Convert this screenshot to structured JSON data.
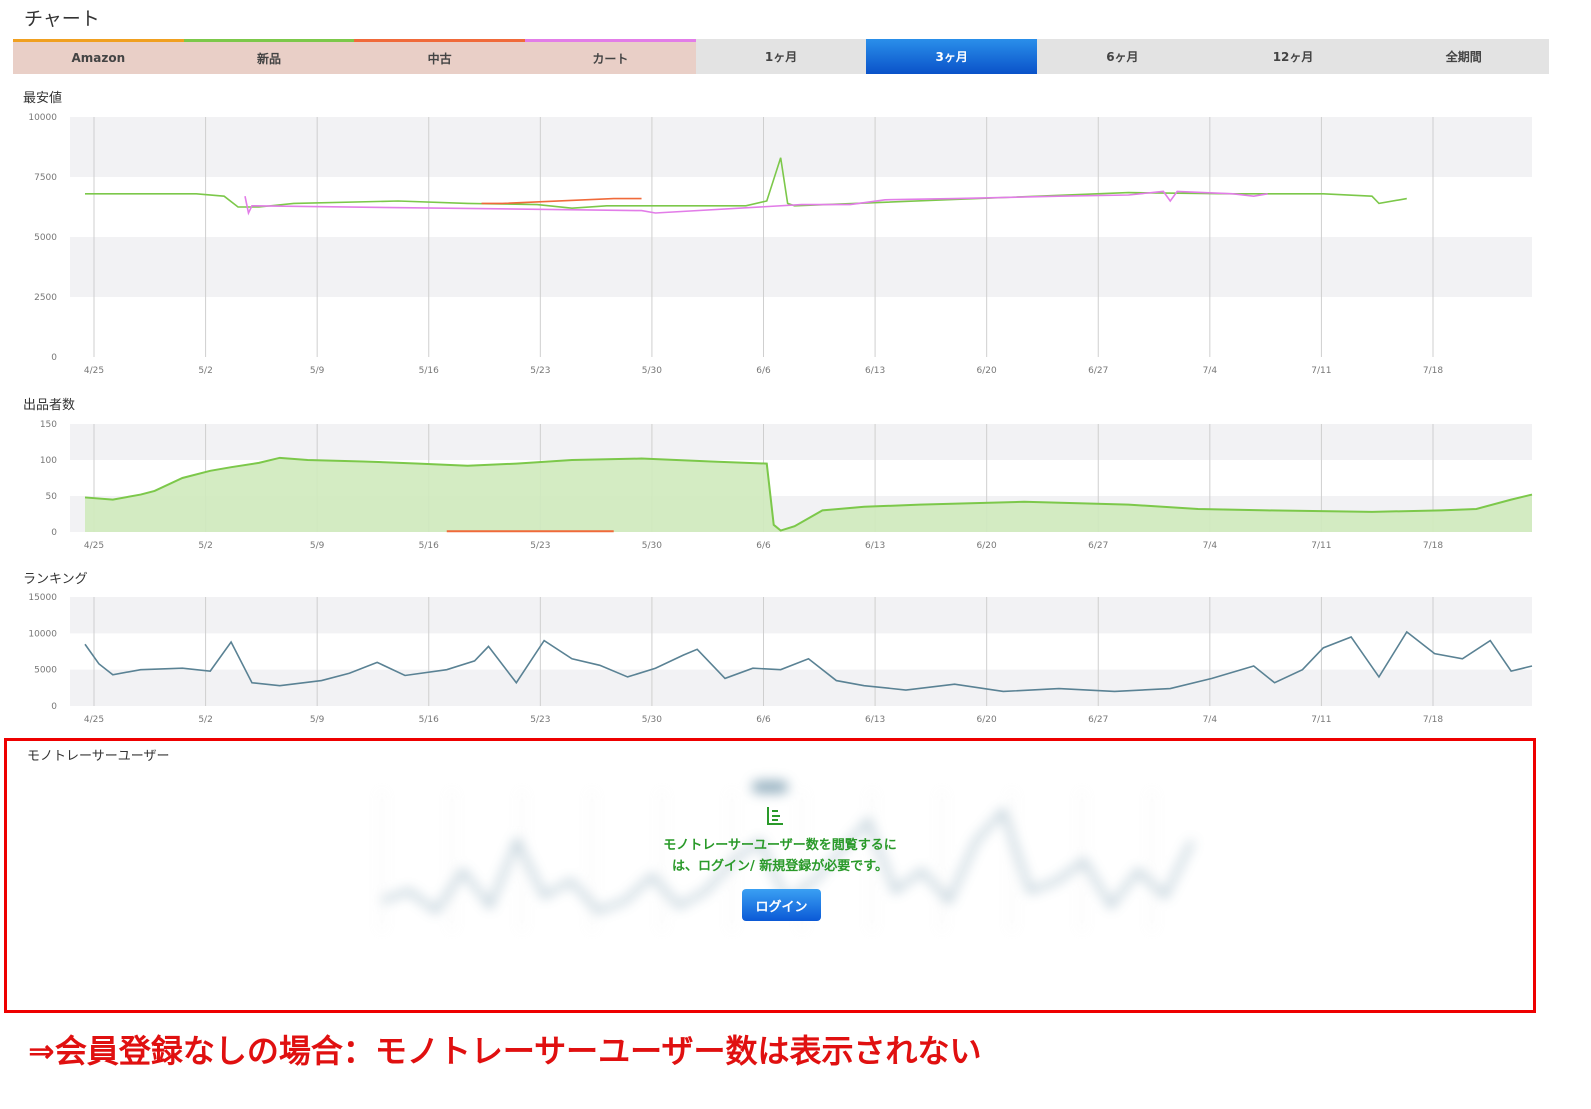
{
  "page_title": "チャート",
  "filters": [
    {
      "label": "Amazon",
      "color": "#f0a020"
    },
    {
      "label": "新品",
      "color": "#7cc84a"
    },
    {
      "label": "中古",
      "color": "#f06a3a"
    },
    {
      "label": "カート",
      "color": "#e27de8"
    }
  ],
  "periods": [
    {
      "label": "1ヶ月",
      "active": false
    },
    {
      "label": "3ヶ月",
      "active": true
    },
    {
      "label": "6ヶ月",
      "active": false
    },
    {
      "label": "12ヶ月",
      "active": false
    },
    {
      "label": "全期間",
      "active": false
    }
  ],
  "chart_data": [
    {
      "type": "line",
      "title": "最安値",
      "x": [
        "4/25",
        "5/2",
        "5/9",
        "5/16",
        "5/23",
        "5/30",
        "6/6",
        "6/13",
        "6/20",
        "6/27",
        "7/4",
        "7/11",
        "7/18"
      ],
      "ylim": [
        0,
        10000
      ],
      "yticks": [
        0,
        2500,
        5000,
        7500,
        10000
      ],
      "grid": true,
      "series": [
        {
          "name": "新品",
          "color": "#7cc84a",
          "points": [
            [
              0,
              6800
            ],
            [
              16,
              6800
            ],
            [
              20,
              6700
            ],
            [
              22,
              6250
            ],
            [
              25,
              6250
            ],
            [
              30,
              6400
            ],
            [
              45,
              6500
            ],
            [
              55,
              6400
            ],
            [
              65,
              6350
            ],
            [
              70,
              6200
            ],
            [
              75,
              6300
            ],
            [
              95,
              6300
            ],
            [
              98,
              6500
            ],
            [
              100,
              8300
            ],
            [
              101,
              6400
            ],
            [
              102,
              6300
            ],
            [
              150,
              6850
            ],
            [
              165,
              6800
            ],
            [
              178,
              6800
            ],
            [
              185,
              6700
            ],
            [
              186,
              6400
            ],
            [
              190,
              6600
            ]
          ]
        },
        {
          "name": "カート",
          "color": "#e27de8",
          "points": [
            [
              23,
              6700
            ],
            [
              23.5,
              6000
            ],
            [
              24,
              6300
            ],
            [
              80,
              6100
            ],
            [
              82,
              6000
            ],
            [
              103,
              6350
            ],
            [
              110,
              6350
            ],
            [
              115,
              6550
            ],
            [
              125,
              6600
            ],
            [
              140,
              6700
            ],
            [
              150,
              6750
            ],
            [
              155,
              6900
            ],
            [
              156,
              6500
            ],
            [
              157,
              6900
            ],
            [
              165,
              6800
            ],
            [
              168,
              6700
            ],
            [
              170,
              6800
            ]
          ]
        },
        {
          "name": "中古",
          "color": "#f06a3a",
          "points": [
            [
              57,
              6400
            ],
            [
              60,
              6400
            ],
            [
              76,
              6600
            ],
            [
              80,
              6600
            ]
          ]
        }
      ]
    },
    {
      "type": "area",
      "title": "出品者数",
      "x": [
        "4/25",
        "5/2",
        "5/9",
        "5/16",
        "5/23",
        "5/30",
        "6/6",
        "6/13",
        "6/20",
        "6/27",
        "7/4",
        "7/11",
        "7/18"
      ],
      "ylim": [
        0,
        150
      ],
      "yticks": [
        0,
        50,
        100,
        150
      ],
      "grid": true,
      "series": [
        {
          "name": "新品",
          "color": "#7cc84a",
          "points": [
            [
              0,
              48
            ],
            [
              4,
              45
            ],
            [
              8,
              52
            ],
            [
              10,
              57
            ],
            [
              14,
              75
            ],
            [
              18,
              85
            ],
            [
              21,
              90
            ],
            [
              25,
              96
            ],
            [
              28,
              103
            ],
            [
              32,
              100
            ],
            [
              40,
              98
            ],
            [
              48,
              95
            ],
            [
              55,
              92
            ],
            [
              62,
              95
            ],
            [
              70,
              100
            ],
            [
              80,
              102
            ],
            [
              90,
              98
            ],
            [
              98,
              95
            ],
            [
              99,
              10
            ],
            [
              100,
              2
            ],
            [
              102,
              8
            ],
            [
              106,
              30
            ],
            [
              112,
              35
            ],
            [
              120,
              38
            ],
            [
              135,
              42
            ],
            [
              150,
              38
            ],
            [
              160,
              32
            ],
            [
              170,
              30
            ],
            [
              185,
              28
            ],
            [
              195,
              30
            ],
            [
              200,
              32
            ],
            [
              205,
              45
            ],
            [
              208,
              52
            ]
          ]
        },
        {
          "name": "中古",
          "color": "#f06a3a",
          "points": [
            [
              52,
              1
            ],
            [
              54,
              1
            ],
            [
              72,
              1
            ],
            [
              76,
              1
            ]
          ]
        }
      ]
    },
    {
      "type": "line",
      "title": "ランキング",
      "x": [
        "4/25",
        "5/2",
        "5/9",
        "5/16",
        "5/23",
        "5/30",
        "6/6",
        "6/13",
        "6/20",
        "6/27",
        "7/4",
        "7/11",
        "7/18"
      ],
      "ylim": [
        0,
        15000
      ],
      "yticks": [
        0,
        5000,
        10000,
        15000
      ],
      "grid": true,
      "series": [
        {
          "name": "ランキング",
          "color": "#5a8294",
          "points": [
            [
              0,
              8500
            ],
            [
              2,
              5800
            ],
            [
              4,
              4300
            ],
            [
              8,
              5000
            ],
            [
              14,
              5200
            ],
            [
              18,
              4800
            ],
            [
              21,
              8800
            ],
            [
              24,
              3200
            ],
            [
              28,
              2800
            ],
            [
              34,
              3500
            ],
            [
              38,
              4500
            ],
            [
              42,
              6000
            ],
            [
              46,
              4200
            ],
            [
              52,
              5000
            ],
            [
              56,
              6200
            ],
            [
              58,
              8200
            ],
            [
              62,
              3200
            ],
            [
              66,
              9000
            ],
            [
              70,
              6500
            ],
            [
              74,
              5600
            ],
            [
              78,
              4000
            ],
            [
              82,
              5200
            ],
            [
              86,
              7000
            ],
            [
              88,
              7800
            ],
            [
              92,
              3800
            ],
            [
              96,
              5200
            ],
            [
              100,
              5000
            ],
            [
              104,
              6500
            ],
            [
              108,
              3500
            ],
            [
              112,
              2800
            ],
            [
              118,
              2200
            ],
            [
              125,
              3000
            ],
            [
              132,
              2000
            ],
            [
              140,
              2400
            ],
            [
              148,
              2000
            ],
            [
              156,
              2400
            ],
            [
              162,
              3800
            ],
            [
              168,
              5500
            ],
            [
              171,
              3200
            ],
            [
              175,
              5000
            ],
            [
              178,
              8000
            ],
            [
              182,
              9500
            ],
            [
              186,
              4000
            ],
            [
              190,
              10200
            ],
            [
              194,
              7200
            ],
            [
              198,
              6500
            ],
            [
              202,
              9000
            ],
            [
              205,
              4800
            ],
            [
              208,
              5500
            ]
          ]
        }
      ]
    }
  ],
  "members": {
    "label": "モノトレーサーユーザー",
    "message_line1": "モノトレーサーユーザー数を閲覧するに",
    "message_line2": "は、ログイン/ 新規登録が必要です。",
    "login_label": "ログイン",
    "blurred_tab": ""
  },
  "note": "⇒会員登録なしの場合：モノトレーサーユーザー数は表示されない"
}
